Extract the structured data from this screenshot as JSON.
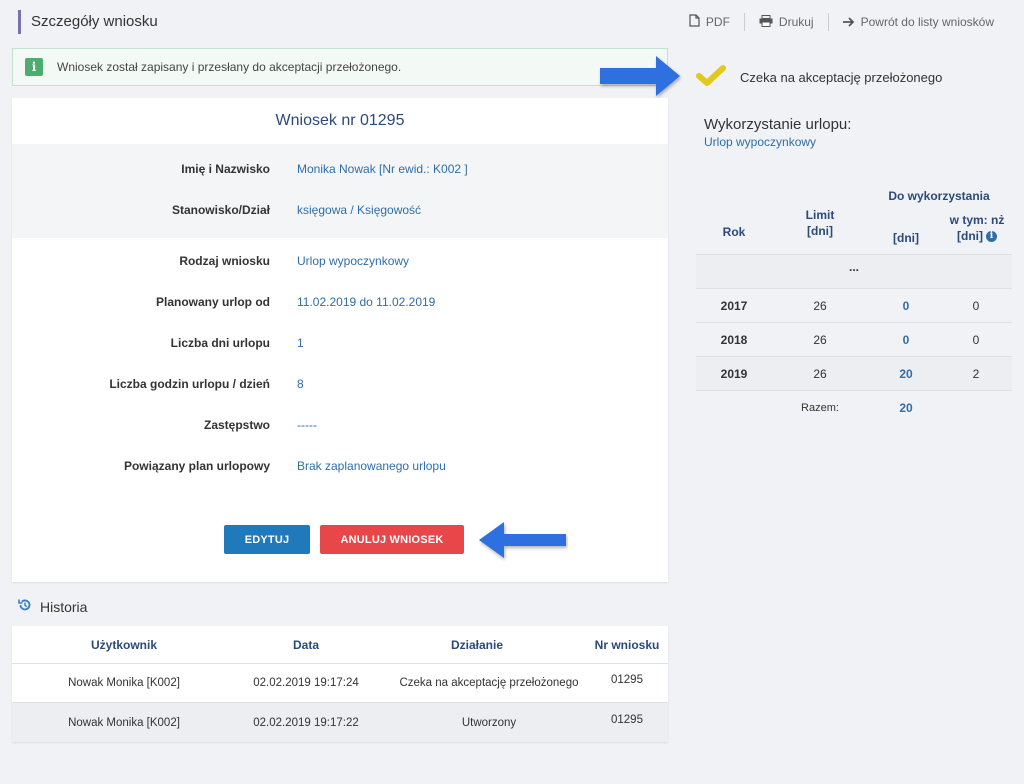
{
  "header": {
    "title": "Szczegóły wniosku",
    "toolbar": {
      "pdf": "PDF",
      "print": "Drukuj",
      "back": "Powrót do listy wniosków"
    }
  },
  "alert": {
    "icon": "info-icon",
    "text": "Wniosek został zapisany i przesłany do akceptacji przełożonego."
  },
  "request": {
    "title": "Wniosek nr 01295",
    "fields": [
      {
        "label": "Imię i Nazwisko",
        "value": "Monika Nowak [Nr ewid.: K002 ]"
      },
      {
        "label": "Stanowisko/Dział",
        "value": "księgowa / Księgowość"
      },
      {
        "label": "Rodzaj wniosku",
        "value": "Urlop wypoczynkowy"
      },
      {
        "label": "Planowany urlop od",
        "value": "11.02.2019 do 11.02.2019"
      },
      {
        "label": "Liczba dni urlopu",
        "value": "1"
      },
      {
        "label": "Liczba godzin urlopu / dzień",
        "value": "8"
      },
      {
        "label": "Zastępstwo",
        "value": "-----"
      },
      {
        "label": "Powiązany plan urlopowy",
        "value": "Brak zaplanowanego urlopu"
      }
    ],
    "buttons": {
      "edit": "EDYTUJ",
      "cancel": "ANULUJ WNIOSEK"
    }
  },
  "history": {
    "title": "Historia",
    "columns": [
      "Użytkownik",
      "Data",
      "Działanie",
      "Nr wniosku"
    ],
    "rows": [
      [
        "Nowak Monika [K002]",
        "02.02.2019 19:17:24",
        "Czeka na akceptację przełożonego",
        "01295"
      ],
      [
        "Nowak Monika [K002]",
        "02.02.2019 19:17:22",
        "Utworzony",
        "01295"
      ]
    ]
  },
  "status": {
    "text": "Czeka na akceptację przełożonego",
    "icon": "checkmark-icon"
  },
  "usage": {
    "title": "Wykorzystanie urlopu:",
    "subtitle": "Urlop wypoczynkowy",
    "header": {
      "year": "Rok",
      "limit": "Limit",
      "limit_unit": "[dni]",
      "available": "Do wykorzystania",
      "available_unit": "[dni]",
      "of_which": "w tym: nż",
      "of_which_unit": "[dni]"
    },
    "ellipsis": "...",
    "rows": [
      {
        "year": "2017",
        "limit": "26",
        "available": "0",
        "nz": "0"
      },
      {
        "year": "2018",
        "limit": "26",
        "available": "0",
        "nz": "0"
      },
      {
        "year": "2019",
        "limit": "26",
        "available": "20",
        "nz": "2"
      }
    ],
    "total_label": "Razem:",
    "total_value": "20"
  },
  "colors": {
    "accent": "#2f6ea8",
    "edit": "#1f79ba",
    "cancel": "#e8474a",
    "check": "#e3c91c",
    "arrow": "#2f6fe0"
  }
}
